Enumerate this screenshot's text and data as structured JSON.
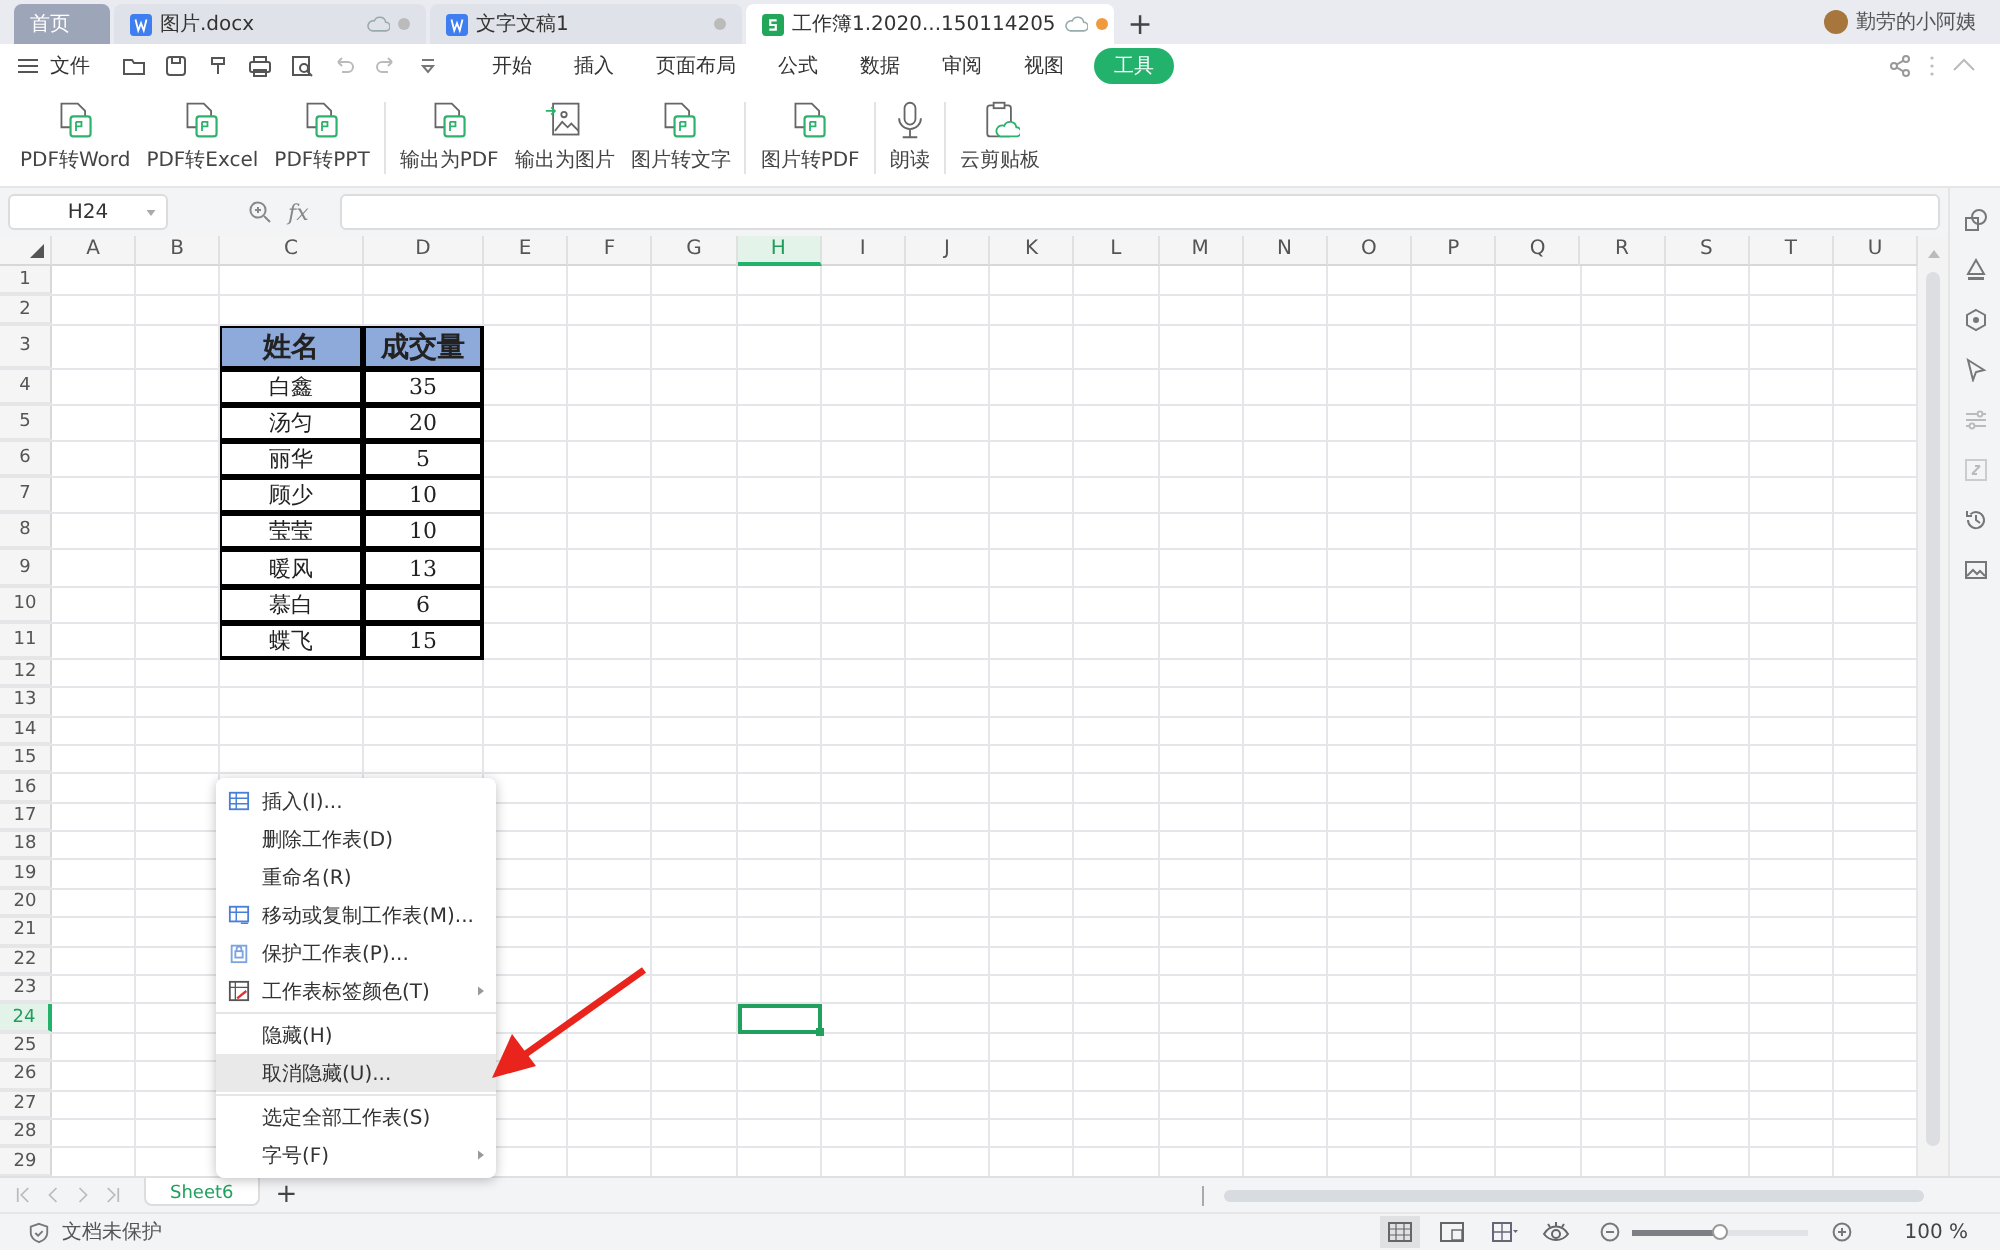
{
  "tabs": [
    {
      "label": "首页",
      "kind": "home",
      "selected": false
    },
    {
      "label": "图片.docx",
      "kind": "writer",
      "selected": false,
      "cloud": true,
      "modified": false
    },
    {
      "label": "文字文稿1",
      "kind": "writer",
      "selected": false,
      "cloud": false,
      "modified": false
    },
    {
      "label": "工作簿1.2020...150114205",
      "kind": "sheet",
      "selected": true,
      "cloud": true,
      "modified": true
    }
  ],
  "new_tab": "+",
  "user": {
    "name": "勤劳的小阿姨"
  },
  "file_menu": "文件",
  "ribbon_tabs": [
    {
      "label": "开始",
      "selected": false
    },
    {
      "label": "插入",
      "selected": false
    },
    {
      "label": "页面布局",
      "selected": false
    },
    {
      "label": "公式",
      "selected": false
    },
    {
      "label": "数据",
      "selected": false
    },
    {
      "label": "审阅",
      "selected": false
    },
    {
      "label": "视图",
      "selected": false
    },
    {
      "label": "工具",
      "selected": true
    }
  ],
  "tool_groups": [
    [
      {
        "label": "PDF转Word",
        "kind": "doc"
      },
      {
        "label": "PDF转Excel",
        "kind": "doc"
      },
      {
        "label": "PDF转PPT",
        "kind": "doc"
      }
    ],
    [
      {
        "label": "输出为PDF",
        "kind": "doc"
      },
      {
        "label": "输出为图片",
        "kind": "image"
      },
      {
        "label": "图片转文字",
        "kind": "doc"
      }
    ],
    [
      {
        "label": "图片转PDF",
        "kind": "doc"
      }
    ],
    [
      {
        "label": "朗读",
        "kind": "mic"
      }
    ],
    [
      {
        "label": "云剪贴板",
        "kind": "clipboard"
      }
    ]
  ],
  "formula_bar": {
    "name_box": "H24",
    "fx": "fx"
  },
  "columns": [
    {
      "label": "A",
      "selected": false
    },
    {
      "label": "B",
      "selected": false
    },
    {
      "label": "C",
      "selected": false
    },
    {
      "label": "D",
      "selected": false
    },
    {
      "label": "E",
      "selected": false
    },
    {
      "label": "F",
      "selected": false
    },
    {
      "label": "G",
      "selected": false
    },
    {
      "label": "H",
      "selected": true
    },
    {
      "label": "I",
      "selected": false
    },
    {
      "label": "J",
      "selected": false
    },
    {
      "label": "K",
      "selected": false
    },
    {
      "label": "L",
      "selected": false
    },
    {
      "label": "M",
      "selected": false
    },
    {
      "label": "N",
      "selected": false
    },
    {
      "label": "O",
      "selected": false
    },
    {
      "label": "P",
      "selected": false
    },
    {
      "label": "Q",
      "selected": false
    },
    {
      "label": "R",
      "selected": false
    },
    {
      "label": "S",
      "selected": false
    },
    {
      "label": "T",
      "selected": false
    },
    {
      "label": "U",
      "selected": false
    }
  ],
  "rows": [
    {
      "label": "1",
      "selected": false
    },
    {
      "label": "2",
      "selected": false
    },
    {
      "label": "3",
      "selected": false
    },
    {
      "label": "4",
      "selected": false
    },
    {
      "label": "5",
      "selected": false
    },
    {
      "label": "6",
      "selected": false
    },
    {
      "label": "7",
      "selected": false
    },
    {
      "label": "8",
      "selected": false
    },
    {
      "label": "9",
      "selected": false
    },
    {
      "label": "10",
      "selected": false
    },
    {
      "label": "11",
      "selected": false
    },
    {
      "label": "12",
      "selected": false
    },
    {
      "label": "13",
      "selected": false
    },
    {
      "label": "14",
      "selected": false
    },
    {
      "label": "15",
      "selected": false
    },
    {
      "label": "16",
      "selected": false
    },
    {
      "label": "17",
      "selected": false
    },
    {
      "label": "18",
      "selected": false
    },
    {
      "label": "19",
      "selected": false
    },
    {
      "label": "20",
      "selected": false
    },
    {
      "label": "21",
      "selected": false
    },
    {
      "label": "22",
      "selected": false
    },
    {
      "label": "23",
      "selected": false
    },
    {
      "label": "24",
      "selected": true
    },
    {
      "label": "25",
      "selected": false
    },
    {
      "label": "26",
      "selected": false
    },
    {
      "label": "27",
      "selected": false
    },
    {
      "label": "28",
      "selected": false
    },
    {
      "label": "29",
      "selected": false
    }
  ],
  "table": {
    "header": [
      "姓名",
      "成交量"
    ],
    "rows": [
      [
        "白鑫",
        "35"
      ],
      [
        "汤匀",
        "20"
      ],
      [
        "丽华",
        "5"
      ],
      [
        "顾少",
        "10"
      ],
      [
        "莹莹",
        "10"
      ],
      [
        "暖风",
        "13"
      ],
      [
        "慕白",
        "6"
      ],
      [
        "蝶飞",
        "15"
      ]
    ]
  },
  "context_menu": [
    {
      "label": "插入(I)...",
      "submenu": false,
      "divider_before": false,
      "selected": false
    },
    {
      "label": "删除工作表(D)",
      "submenu": false,
      "divider_before": false,
      "selected": false
    },
    {
      "label": "重命名(R)",
      "submenu": false,
      "divider_before": false,
      "selected": false
    },
    {
      "label": "移动或复制工作表(M)...",
      "submenu": false,
      "divider_before": false,
      "selected": false
    },
    {
      "label": "保护工作表(P)...",
      "submenu": false,
      "divider_before": false,
      "selected": false
    },
    {
      "label": "工作表标签颜色(T)",
      "submenu": true,
      "divider_before": false,
      "selected": false
    },
    {
      "label": "隐藏(H)",
      "submenu": false,
      "divider_before": true,
      "selected": false
    },
    {
      "label": "取消隐藏(U)...",
      "submenu": false,
      "divider_before": false,
      "selected": true
    },
    {
      "label": "选定全部工作表(S)",
      "submenu": false,
      "divider_before": true,
      "selected": false
    },
    {
      "label": "字号(F)",
      "submenu": true,
      "divider_before": false,
      "selected": false
    }
  ],
  "sheets": [
    {
      "label": "Sheet6",
      "selected": true
    }
  ],
  "add_sheet": "+",
  "status_bar": {
    "protection": "文档未保护",
    "zoom_slider": {
      "level": 0.5
    },
    "zoom": "100 %"
  }
}
